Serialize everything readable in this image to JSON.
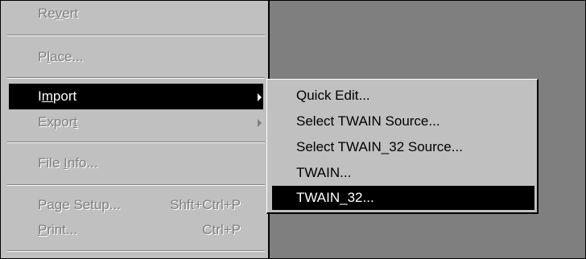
{
  "file_menu": {
    "items": [
      {
        "label": "Revert",
        "hotkey": "v",
        "enabled": false
      },
      {
        "label": "Place...",
        "hotkey": "l",
        "enabled": false
      },
      {
        "label": "Import",
        "hotkey": "m",
        "enabled": true,
        "highlighted": true,
        "has_submenu": true
      },
      {
        "label": "Export",
        "hotkey": "t",
        "enabled": false,
        "has_submenu": true
      },
      {
        "label": "File Info...",
        "hotkey": "I",
        "enabled": false
      },
      {
        "label": "Page Setup...",
        "shortcut": "Shft+Ctrl+P",
        "enabled": false
      },
      {
        "label": "Print...",
        "hotkey": "P",
        "shortcut": "Ctrl+P",
        "enabled": false
      }
    ]
  },
  "import_submenu": {
    "items": [
      {
        "label": "Quick Edit..."
      },
      {
        "label": "Select TWAIN Source..."
      },
      {
        "label": "Select TWAIN_32 Source..."
      },
      {
        "label": "TWAIN..."
      },
      {
        "label": "TWAIN_32...",
        "highlighted": true
      }
    ]
  },
  "colors": {
    "menu_bg": "#c0c0c0",
    "highlight_bg": "#000000",
    "disabled_text": "#808080",
    "desktop_bg": "#7f7f7f"
  }
}
